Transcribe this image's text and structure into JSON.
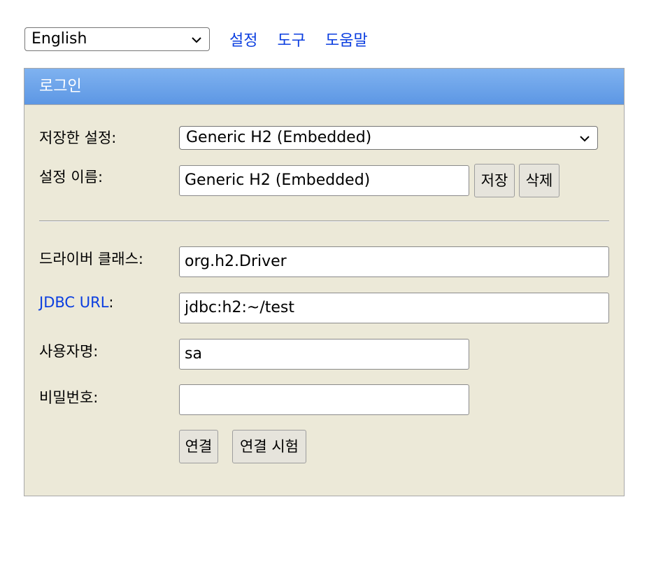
{
  "topbar": {
    "language": "English",
    "links": [
      "설정",
      "도구",
      "도움말"
    ]
  },
  "login": {
    "title": "로그인",
    "saved_settings_label": "저장한 설정:",
    "saved_settings_value": "Generic H2 (Embedded)",
    "setting_name_label": "설정 이름:",
    "setting_name_value": "Generic H2 (Embedded)",
    "save_button": "저장",
    "delete_button": "삭제",
    "driver_class_label": "드라이버 클래스:",
    "driver_class_value": "org.h2.Driver",
    "jdbc_url_link": "JDBC URL",
    "jdbc_url_colon": ":",
    "jdbc_url_value": "jdbc:h2:~/test",
    "username_label": "사용자명:",
    "username_value": "sa",
    "password_label": "비밀번호:",
    "password_value": "",
    "connect_button": "연결",
    "test_connection_button": "연결 시험"
  },
  "colors": {
    "link": "#0b3ee0",
    "panel_bg": "#ece9d8",
    "header_bg": "#6fa6ec"
  }
}
